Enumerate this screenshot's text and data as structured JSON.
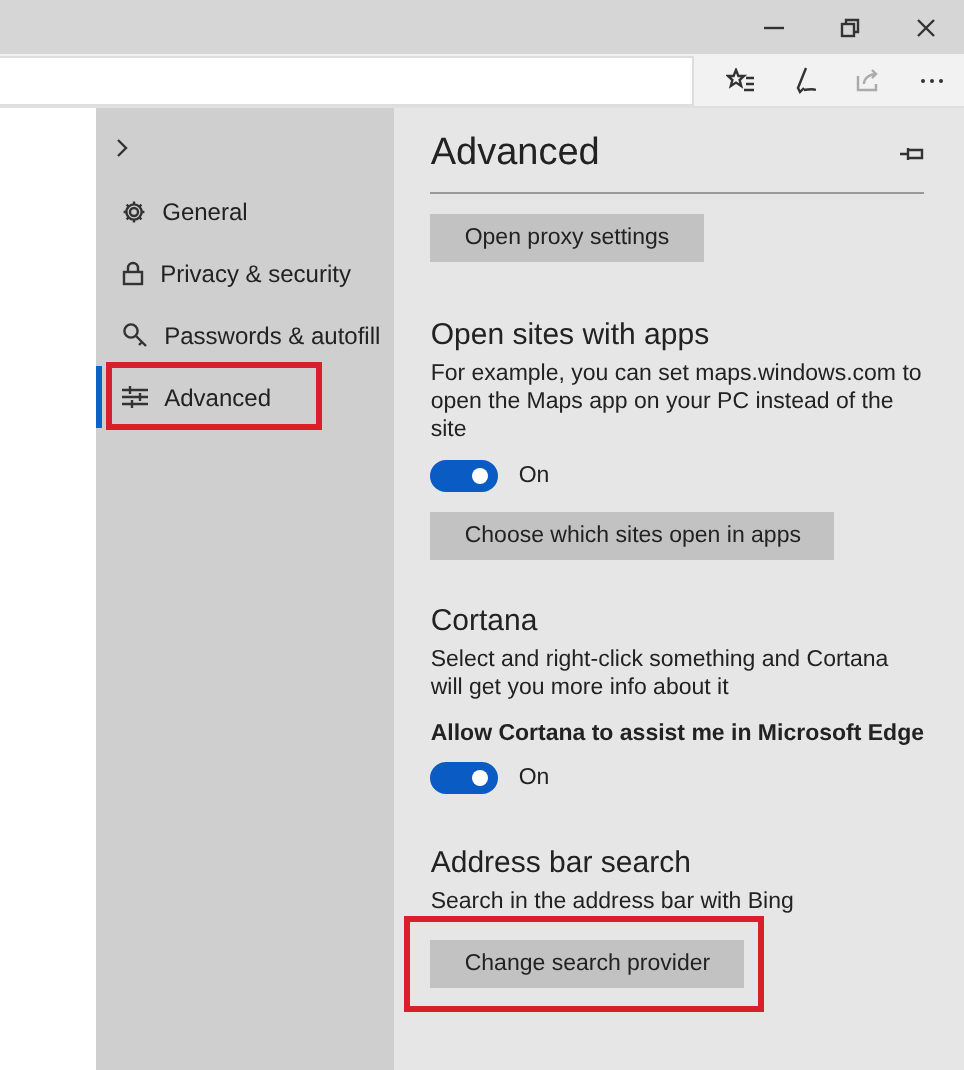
{
  "sidebar": {
    "items": [
      {
        "label": "General",
        "selected": false,
        "highlighted": false
      },
      {
        "label": "Privacy & security",
        "selected": false,
        "highlighted": false
      },
      {
        "label": "Passwords & autofill",
        "selected": false,
        "highlighted": false
      },
      {
        "label": "Advanced",
        "selected": true,
        "highlighted": true
      }
    ]
  },
  "panel": {
    "title": "Advanced",
    "sections": [
      {
        "button": "Open proxy settings",
        "highlighted": false
      },
      {
        "title": "Open sites with apps",
        "description": "For example, you can set maps.windows.com to open the Maps app on your PC instead of the site",
        "toggle": {
          "on": true,
          "label": "On"
        },
        "button": "Choose which sites open in apps",
        "highlighted": false
      },
      {
        "title": "Cortana",
        "description": "Select and right-click something and Cortana will get you more info about it",
        "setting_label": "Allow Cortana to assist me in Microsoft Edge",
        "toggle": {
          "on": true,
          "label": "On"
        },
        "highlighted": false
      },
      {
        "title": "Address bar search",
        "description": "Search in the address bar with Bing",
        "button": "Change search provider",
        "highlighted": true
      }
    ]
  }
}
